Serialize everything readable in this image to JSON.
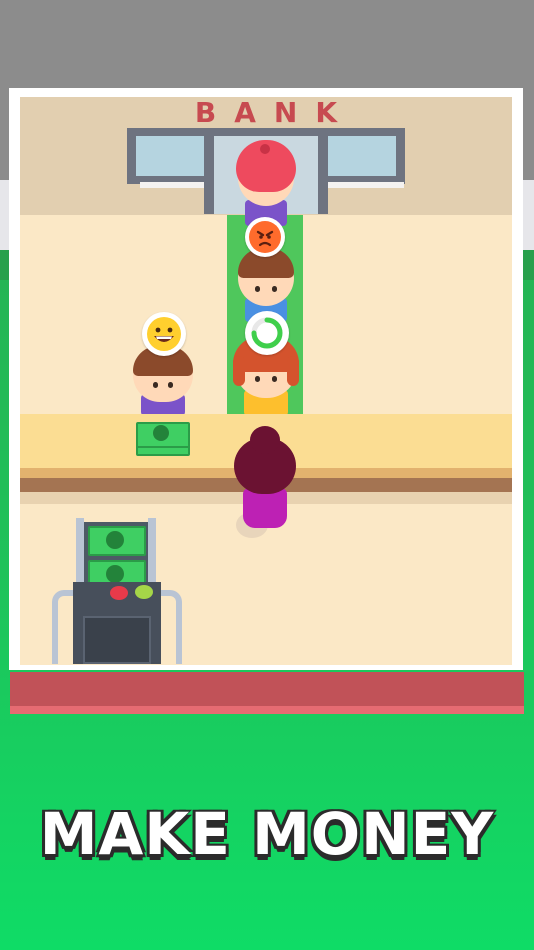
{
  "bank": {
    "title": "BANK"
  },
  "caption": {
    "text": "MAKE MONEY"
  },
  "queue": [
    {
      "role": "customer",
      "mood": "none",
      "hair": "red-cap",
      "shirt": "purple"
    },
    {
      "role": "customer",
      "mood": "angry",
      "hair": "brown",
      "shirt": "blue"
    },
    {
      "role": "customer",
      "mood": "waiting",
      "hair": "auburn",
      "shirt": "yellow"
    }
  ],
  "served_customer": {
    "mood": "happy",
    "hair": "brown",
    "shirt": "purple"
  },
  "cashier": {
    "hair": "maroon",
    "shirt": "magenta"
  },
  "colors": {
    "accent_red": "#c74a50",
    "queue_green": "#4fc75c",
    "money_green": "#3fcf63",
    "background_green": "#1fc25a"
  },
  "icons": [
    "angry-face-icon",
    "loading-icon",
    "grin-face-icon",
    "cash-stack-icon",
    "cash-machine-icon"
  ]
}
